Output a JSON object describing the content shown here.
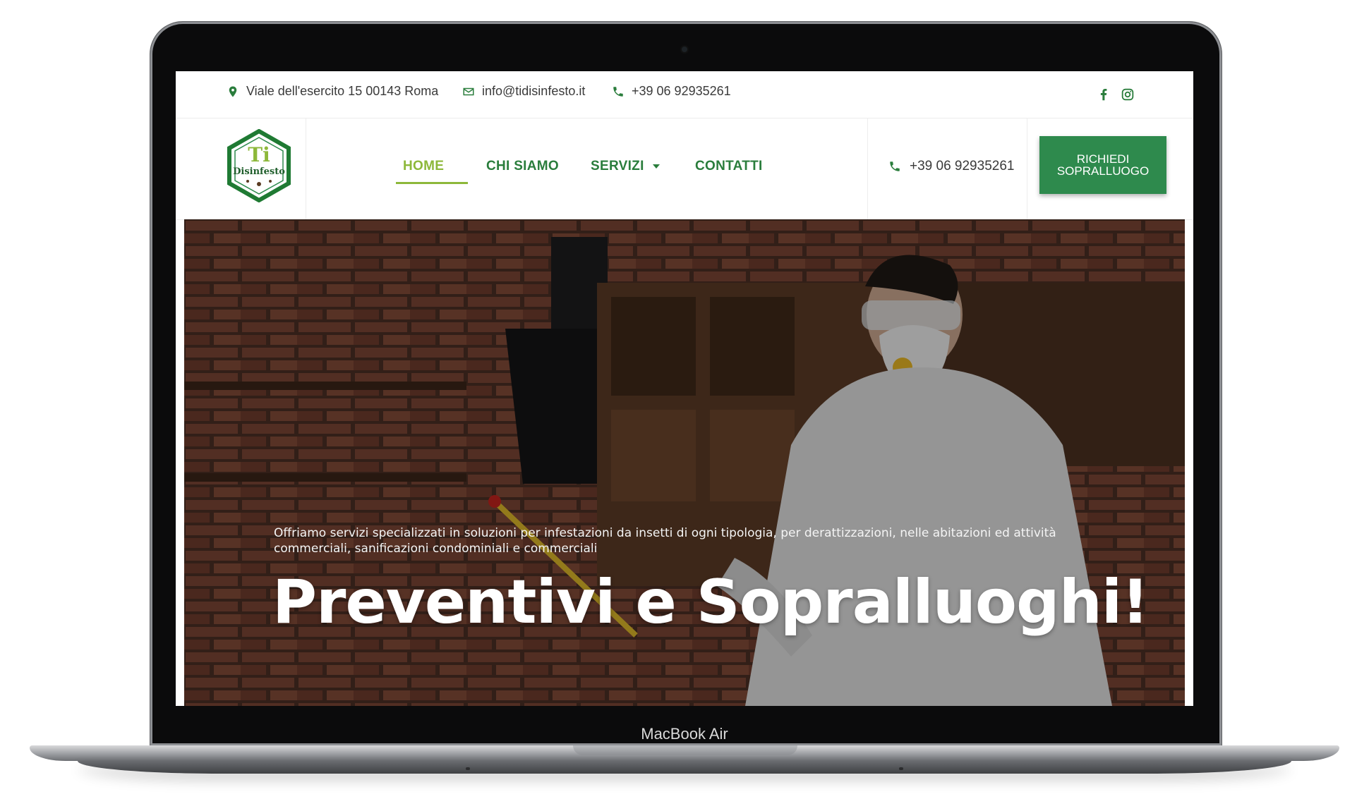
{
  "device": {
    "label": "MacBook Air"
  },
  "topbar": {
    "address": "Viale dell'esercito 15 00143 Roma",
    "email": "info@tidisinfesto.it",
    "phone": "+39 06 92935261",
    "social": [
      {
        "icon": "facebook-icon"
      },
      {
        "icon": "instagram-icon"
      }
    ]
  },
  "logo": {
    "text": "Disinfesto",
    "monogram": "Ti"
  },
  "nav": {
    "items": [
      {
        "label": "HOME",
        "active": true
      },
      {
        "label": "CHI SIAMO",
        "active": false
      },
      {
        "label": "SERVIZI",
        "active": false,
        "dropdown": true
      },
      {
        "label": "CONTATTI",
        "active": false
      }
    ],
    "phone": "+39 06 92935261",
    "cta": {
      "line1": "RICHIEDI",
      "line2": "SOPRALLUOGO"
    }
  },
  "hero": {
    "subtitle": "Offriamo servizi specializzati in soluzioni per infestazioni da insetti di ogni tipologia, per derattizzazioni, nelle abitazioni ed attività commerciali, sanificazioni condominiali e commerciali",
    "title": "Preventivi e Sopralluoghi!"
  },
  "colors": {
    "brand_green": "#2e8a4d",
    "nav_green": "#2a7d3c",
    "active_lime": "#8db83a"
  }
}
